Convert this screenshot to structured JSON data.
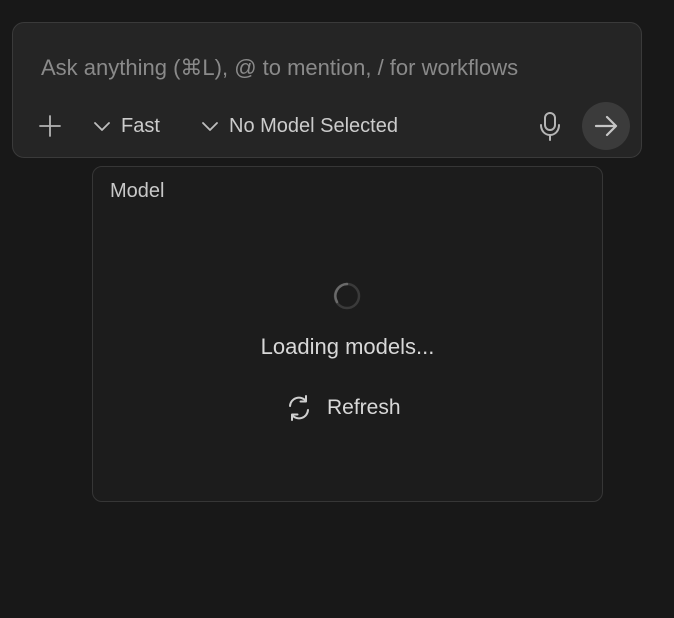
{
  "chat": {
    "placeholder": "Ask anything (⌘L), @ to mention, / for workflows",
    "value": "",
    "mode_label": "Fast",
    "model_label": "No Model Selected",
    "icons": {
      "add": "plus-icon",
      "mode_chevron": "chevron-down-icon",
      "model_chevron": "chevron-down-icon",
      "mic": "microphone-icon",
      "send": "arrow-right-icon"
    }
  },
  "model_panel": {
    "title": "Model",
    "loading_text": "Loading models...",
    "refresh_label": "Refresh",
    "icons": {
      "spinner": "loading-spinner-icon",
      "refresh": "refresh-icon"
    }
  },
  "colors": {
    "background": "#181818",
    "input_background": "#252525",
    "panel_background": "#1c1c1c",
    "border": "#3a3a3a",
    "text": "#d8d8d8",
    "muted_text": "#8a8a8a",
    "send_button": "#3b3b3b"
  }
}
